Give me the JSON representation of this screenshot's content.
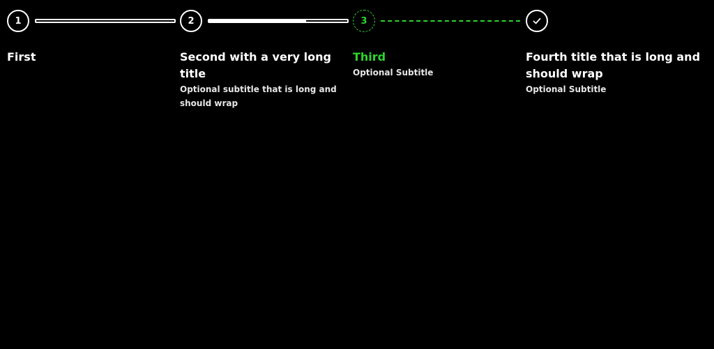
{
  "colors": {
    "background": "#000000",
    "default": "#ffffff",
    "active": "#2ed52e"
  },
  "steps": [
    {
      "marker": "1",
      "title": "First",
      "subtitle": "",
      "state": "default",
      "connector_progress": 0
    },
    {
      "marker": "2",
      "title": "Second with a very long title",
      "subtitle": "Optional subtitle that is long and should wrap",
      "state": "default",
      "connector_progress": 0.7
    },
    {
      "marker": "3",
      "title": "Third",
      "subtitle": "Optional Subtitle",
      "state": "active",
      "connector_progress": 0
    },
    {
      "marker_icon": "check-icon",
      "title": "Fourth title that is long and should wrap",
      "subtitle": "Optional Subtitle",
      "state": "completed"
    }
  ]
}
